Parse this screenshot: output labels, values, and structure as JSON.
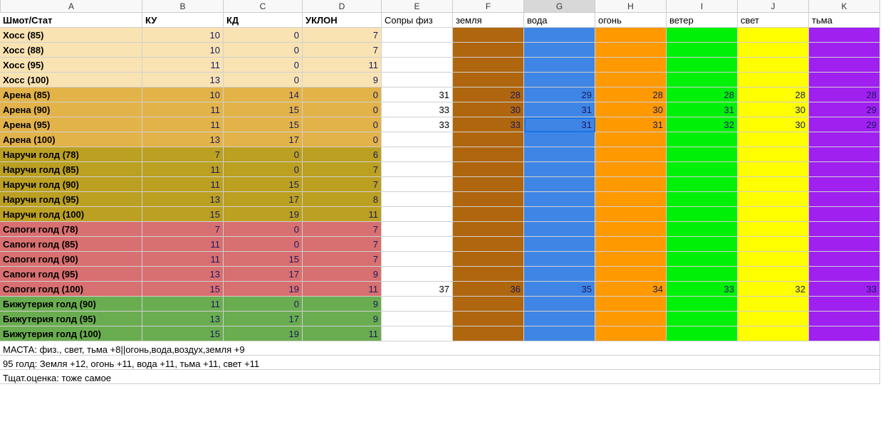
{
  "columns": [
    "A",
    "B",
    "C",
    "D",
    "E",
    "F",
    "G",
    "H",
    "I",
    "J",
    "K"
  ],
  "selected_column_index": 6,
  "active_cell": {
    "row": 7,
    "col": 6
  },
  "header_row": [
    "Шмот/Стат",
    "КУ",
    "КД",
    "УКЛОН",
    "Сопры физ",
    "земля",
    "вода",
    "огонь",
    "ветер",
    "свет",
    "тьма"
  ],
  "element_colors": [
    "bg-white",
    "bg-brown",
    "bg-blue",
    "bg-orange",
    "bg-lime",
    "bg-yellow",
    "bg-purple"
  ],
  "rows": [
    {
      "class": "bg-cream",
      "label": "Хосс (85)",
      "ку": "10",
      "кд": "0",
      "уклон": "7",
      "elem": [
        "",
        "",
        "",
        "",
        "",
        "",
        ""
      ]
    },
    {
      "class": "bg-cream",
      "label": "Хосс (88)",
      "ку": "10",
      "кд": "0",
      "уклон": "7",
      "elem": [
        "",
        "",
        "",
        "",
        "",
        "",
        ""
      ]
    },
    {
      "class": "bg-cream",
      "label": "Хосс (95)",
      "ку": "11",
      "кд": "0",
      "уклон": "11",
      "elem": [
        "",
        "",
        "",
        "",
        "",
        "",
        ""
      ]
    },
    {
      "class": "bg-cream",
      "label": "Хосс (100)",
      "ку": "13",
      "кд": "0",
      "уклон": "9",
      "elem": [
        "",
        "",
        "",
        "",
        "",
        "",
        ""
      ]
    },
    {
      "class": "bg-amber",
      "label": "Арена (85)",
      "ку": "10",
      "кд": "14",
      "уклон": "0",
      "elem": [
        "31",
        "28",
        "29",
        "28",
        "28",
        "28",
        "28"
      ]
    },
    {
      "class": "bg-amber",
      "label": "Арена (90)",
      "ку": "11",
      "кд": "15",
      "уклон": "0",
      "elem": [
        "33",
        "30",
        "31",
        "30",
        "31",
        "30",
        "29"
      ]
    },
    {
      "class": "bg-amber",
      "label": "Арена (95)",
      "ку": "11",
      "кд": "15",
      "уклон": "0",
      "elem": [
        "33",
        "33",
        "31",
        "31",
        "32",
        "30",
        "29"
      ]
    },
    {
      "class": "bg-amber",
      "label": "Арена (100)",
      "ку": "13",
      "кд": "17",
      "уклон": "0",
      "elem": [
        "",
        "",
        "",
        "",
        "",
        "",
        ""
      ]
    },
    {
      "class": "bg-olive",
      "label": "Наручи голд (78)",
      "ку": "7",
      "кд": "0",
      "уклон": "6",
      "elem": [
        "",
        "",
        "",
        "",
        "",
        "",
        ""
      ]
    },
    {
      "class": "bg-olive",
      "label": "Наручи голд (85)",
      "ку": "11",
      "кд": "0",
      "уклон": "7",
      "elem": [
        "",
        "",
        "",
        "",
        "",
        "",
        ""
      ]
    },
    {
      "class": "bg-olive",
      "label": "Наручи голд (90)",
      "ку": "11",
      "кд": "15",
      "уклон": "7",
      "elem": [
        "",
        "",
        "",
        "",
        "",
        "",
        ""
      ]
    },
    {
      "class": "bg-olive",
      "label": "Наручи голд (95)",
      "ку": "13",
      "кд": "17",
      "уклон": "8",
      "elem": [
        "",
        "",
        "",
        "",
        "",
        "",
        ""
      ]
    },
    {
      "class": "bg-olive",
      "label": "Наручи голд (100)",
      "ку": "15",
      "кд": "19",
      "уклон": "11",
      "elem": [
        "",
        "",
        "",
        "",
        "",
        "",
        ""
      ]
    },
    {
      "class": "bg-pink",
      "label": "Сапоги голд (78)",
      "ку": "7",
      "кд": "0",
      "уклон": "7",
      "elem": [
        "",
        "",
        "",
        "",
        "",
        "",
        ""
      ]
    },
    {
      "class": "bg-pink",
      "label": "Сапоги голд (85)",
      "ку": "11",
      "кд": "0",
      "уклон": "7",
      "elem": [
        "",
        "",
        "",
        "",
        "",
        "",
        ""
      ]
    },
    {
      "class": "bg-pink",
      "label": "Сапоги голд (90)",
      "ку": "11",
      "кд": "15",
      "уклон": "7",
      "elem": [
        "",
        "",
        "",
        "",
        "",
        "",
        ""
      ]
    },
    {
      "class": "bg-pink",
      "label": "Сапоги голд (95)",
      "ку": "13",
      "кд": "17",
      "уклон": "9",
      "elem": [
        "",
        "",
        "",
        "",
        "",
        "",
        ""
      ]
    },
    {
      "class": "bg-pink",
      "label": "Сапоги голд (100)",
      "ку": "15",
      "кд": "19",
      "уклон": "11",
      "elem": [
        "37",
        "36",
        "35",
        "34",
        "33",
        "32",
        "33"
      ]
    },
    {
      "class": "bg-green",
      "label": "Бижутерия голд (90)",
      "ку": "11",
      "кд": "0",
      "уклон": "9",
      "elem": [
        "",
        "",
        "",
        "",
        "",
        "",
        ""
      ]
    },
    {
      "class": "bg-green",
      "label": "Бижутерия голд (95)",
      "ку": "13",
      "кд": "17",
      "уклон": "9",
      "elem": [
        "",
        "",
        "",
        "",
        "",
        "",
        ""
      ]
    },
    {
      "class": "bg-green",
      "label": "Бижутерия голд (100)",
      "ку": "15",
      "кд": "19",
      "уклон": "11",
      "elem": [
        "",
        "",
        "",
        "",
        "",
        "",
        ""
      ]
    }
  ],
  "notes": [
    "МАСТА: физ., свет, тьма +8||огонь,вода,воздух,земля +9",
    "95 голд: Земля +12, огонь +11, вода +11, тьма +11, свет +11",
    "Тщат.оценка: тоже самое"
  ]
}
